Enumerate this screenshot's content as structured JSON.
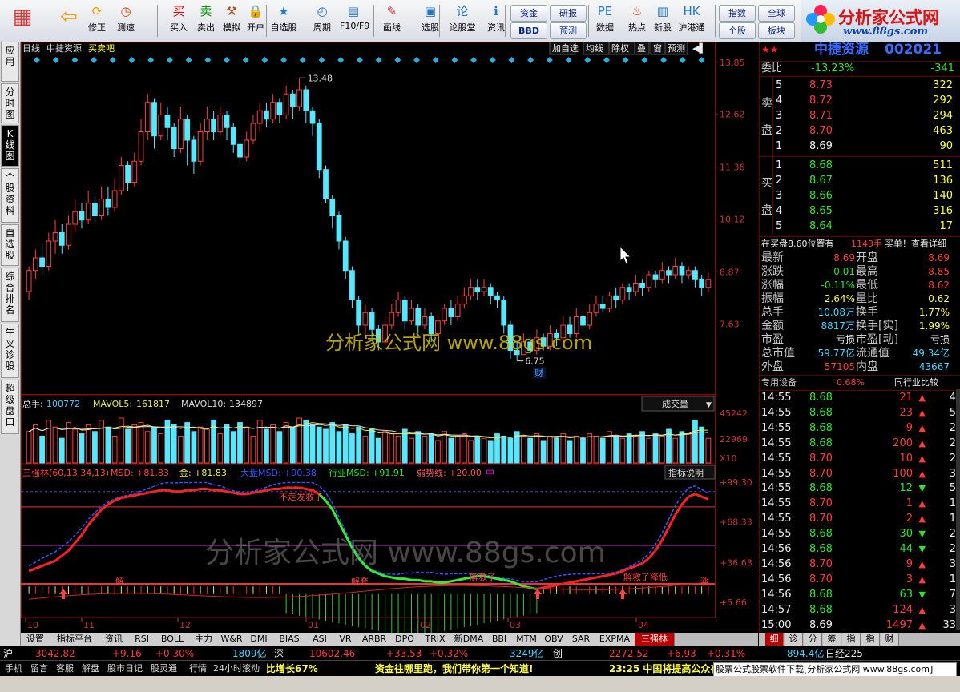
{
  "toolbar": {
    "buttons": [
      {
        "label": "",
        "icon": "windows-grid-icon"
      },
      {
        "label": "",
        "icon": "back-arrow-icon"
      },
      {
        "label": "修正",
        "icon": "refresh-icon"
      },
      {
        "label": "测速",
        "icon": "clock-icon"
      },
      {
        "label": "买入",
        "icon": "buy-icon"
      },
      {
        "label": "卖出",
        "icon": "sell-icon"
      },
      {
        "label": "模拟",
        "icon": "hammer-icon"
      },
      {
        "label": "开户",
        "icon": "lock-icon"
      },
      {
        "label": "自选股",
        "icon": "star-icon"
      },
      {
        "label": "周期",
        "icon": "period-icon"
      },
      {
        "label": "F10/F9",
        "icon": "f10-icon"
      },
      {
        "label": "画线",
        "icon": "pencil-icon"
      },
      {
        "label": "选股",
        "icon": "select-icon"
      },
      {
        "label": "论股堂",
        "icon": "forum-icon"
      },
      {
        "label": "资讯",
        "icon": "info-icon"
      },
      {
        "label": "数据",
        "icon": "pe-icon"
      },
      {
        "label": "热点",
        "icon": "fire-icon"
      },
      {
        "label": "新股",
        "icon": "newstock-icon"
      },
      {
        "label": "沪港通",
        "icon": "hk-icon"
      }
    ],
    "small_buttons": [
      "资金",
      "研报",
      "BBD",
      "预测",
      "指数",
      "全球",
      "个股",
      "板块"
    ],
    "logo_title": "分析家公式网",
    "logo_url": "www.88gs.com"
  },
  "left_tabs": [
    "应用",
    "分时图",
    "K线图",
    "个股资料",
    "自选股",
    "综合排名",
    "牛叉诊股",
    "超级盘口"
  ],
  "chart": {
    "period": "日线",
    "stock_name": "中捷资源",
    "tag": "买卖吧",
    "top_buttons": [
      "加自选",
      "均线",
      "除权",
      "叠",
      "窗",
      "预测"
    ],
    "watermark": "分析家公式网 www.88gs.com",
    "price_axis": [
      "13.85",
      "12.62",
      "11.36",
      "10.12",
      "8.87",
      "7.63"
    ],
    "high_label": "13.48",
    "low_label": "6.75",
    "fin_marker": "财",
    "vol_header": {
      "label": "总手:",
      "total": "100772",
      "mavol5_label": "MAVOL5:",
      "mavol5": "161817",
      "mavol10_label": "MAVOL10:",
      "mavol10": "134897"
    },
    "vol_dropdown": "成交量",
    "vol_axis": [
      "45242",
      "22969",
      "X10"
    ],
    "ind_header": {
      "name": "三强林(60,13,34,13)",
      "msd": "MSD: +81.83",
      "gold": "金: +81.83",
      "market": "大盘MSD: +90.38",
      "industry": "行业MSD: +91.91",
      "weak": "弱势线: +20.00",
      "mid": "中"
    },
    "ind_button": "指标说明",
    "ind_axis": [
      "+99.30",
      "+68.33",
      "+36.63",
      "+5.66"
    ],
    "ind_text": {
      "t1": "不走发救了",
      "t2": "解",
      "t3": "解套",
      "t4": "解套了",
      "t5": "解救",
      "t6": "解救了",
      "t7": "解救了降低",
      "t8": "解",
      "t9": "涨"
    },
    "month_labels": [
      "10",
      "11",
      "12",
      "01",
      "02",
      "03",
      "04"
    ]
  },
  "chart_data": {
    "type": "candlestick",
    "title": "",
    "ylim": [
      6.0,
      14.0
    ],
    "price_labels": {
      "high": 13.48,
      "low": 6.75
    },
    "candles": [
      [
        8.4,
        8.9,
        8.2,
        9.0
      ],
      [
        8.9,
        9.2,
        8.7,
        9.4
      ],
      [
        9.2,
        9.0,
        8.8,
        9.5
      ],
      [
        9.0,
        9.6,
        8.9,
        9.8
      ],
      [
        9.6,
        9.8,
        9.3,
        10.1
      ],
      [
        9.8,
        9.5,
        9.3,
        10.0
      ],
      [
        9.5,
        10.0,
        9.4,
        10.2
      ],
      [
        10.0,
        10.3,
        9.8,
        10.6
      ],
      [
        10.3,
        10.1,
        9.9,
        10.5
      ],
      [
        10.1,
        10.5,
        10.0,
        10.8
      ],
      [
        10.5,
        10.2,
        10.0,
        10.7
      ],
      [
        10.2,
        10.6,
        10.1,
        10.9
      ],
      [
        10.6,
        10.4,
        10.2,
        10.9
      ],
      [
        10.4,
        10.8,
        10.3,
        11.1
      ],
      [
        10.8,
        11.4,
        10.7,
        11.6
      ],
      [
        11.4,
        11.0,
        10.8,
        11.5
      ],
      [
        11.0,
        11.5,
        10.9,
        11.7
      ],
      [
        11.5,
        12.2,
        11.4,
        12.5
      ],
      [
        12.2,
        12.9,
        12.0,
        13.1
      ],
      [
        12.9,
        12.1,
        11.8,
        13.0
      ],
      [
        12.1,
        12.6,
        12.0,
        12.9
      ],
      [
        12.6,
        12.3,
        12.0,
        12.8
      ],
      [
        12.3,
        11.8,
        11.6,
        12.4
      ],
      [
        11.8,
        12.5,
        11.7,
        12.8
      ],
      [
        12.5,
        12.0,
        11.4,
        12.6
      ],
      [
        12.0,
        11.5,
        11.2,
        12.1
      ],
      [
        11.5,
        12.2,
        11.4,
        12.4
      ],
      [
        12.2,
        12.5,
        12.0,
        12.8
      ],
      [
        12.5,
        12.2,
        12.0,
        12.7
      ],
      [
        12.2,
        12.6,
        12.1,
        12.8
      ],
      [
        12.6,
        12.3,
        12.0,
        12.7
      ],
      [
        12.3,
        11.9,
        11.7,
        12.4
      ],
      [
        11.9,
        11.6,
        11.4,
        12.0
      ],
      [
        11.6,
        12.0,
        11.5,
        12.2
      ],
      [
        12.0,
        12.4,
        11.9,
        12.6
      ],
      [
        12.4,
        12.7,
        12.2,
        12.9
      ],
      [
        12.7,
        12.5,
        12.3,
        12.9
      ],
      [
        12.5,
        12.9,
        12.4,
        13.1
      ],
      [
        12.9,
        12.6,
        12.4,
        13.0
      ],
      [
        12.6,
        13.1,
        12.5,
        13.3
      ],
      [
        13.1,
        12.8,
        12.5,
        13.2
      ],
      [
        12.8,
        13.2,
        12.7,
        13.48
      ],
      [
        13.2,
        12.7,
        12.4,
        13.3
      ],
      [
        12.7,
        12.4,
        12.1,
        12.8
      ],
      [
        12.4,
        11.3,
        11.1,
        12.5
      ],
      [
        11.3,
        10.6,
        10.5,
        11.4
      ],
      [
        10.6,
        10.2,
        9.9,
        10.7
      ],
      [
        10.2,
        9.6,
        9.4,
        10.3
      ],
      [
        9.6,
        8.9,
        8.7,
        9.7
      ],
      [
        8.9,
        8.2,
        8.0,
        9.0
      ],
      [
        8.2,
        7.6,
        7.4,
        8.3
      ],
      [
        7.6,
        7.9,
        7.3,
        8.1
      ],
      [
        7.9,
        7.5,
        7.3,
        8.0
      ],
      [
        7.5,
        7.2,
        7.0,
        7.6
      ],
      [
        7.2,
        7.6,
        7.1,
        7.8
      ],
      [
        7.6,
        7.9,
        7.5,
        8.1
      ],
      [
        7.9,
        8.2,
        7.8,
        8.4
      ],
      [
        8.2,
        7.7,
        7.5,
        8.3
      ],
      [
        7.7,
        8.0,
        7.6,
        8.2
      ],
      [
        8.0,
        7.6,
        7.4,
        8.1
      ],
      [
        7.6,
        7.8,
        7.5,
        8.0
      ],
      [
        7.8,
        7.4,
        7.2,
        7.9
      ],
      [
        7.4,
        7.7,
        7.3,
        7.9
      ],
      [
        7.7,
        8.0,
        7.6,
        8.1
      ],
      [
        8.0,
        7.8,
        7.6,
        8.2
      ],
      [
        7.8,
        8.1,
        7.7,
        8.3
      ],
      [
        8.1,
        8.3,
        8.0,
        8.5
      ],
      [
        8.3,
        8.5,
        8.2,
        8.7
      ],
      [
        8.5,
        8.4,
        8.2,
        8.7
      ],
      [
        8.4,
        8.5,
        8.3,
        8.7
      ],
      [
        8.5,
        8.3,
        8.1,
        8.6
      ],
      [
        8.3,
        8.2,
        8.0,
        8.4
      ],
      [
        8.2,
        7.6,
        7.4,
        8.3
      ],
      [
        7.6,
        7.0,
        6.8,
        7.7
      ],
      [
        7.0,
        6.9,
        6.75,
        7.2
      ],
      [
        6.9,
        7.2,
        6.9,
        7.4
      ],
      [
        7.2,
        7.0,
        6.9,
        7.3
      ],
      [
        7.0,
        7.3,
        6.9,
        7.5
      ],
      [
        7.3,
        7.1,
        7.0,
        7.4
      ],
      [
        7.1,
        7.4,
        7.0,
        7.6
      ],
      [
        7.4,
        7.3,
        7.1,
        7.5
      ],
      [
        7.3,
        7.6,
        7.2,
        7.8
      ],
      [
        7.6,
        7.4,
        7.3,
        7.8
      ],
      [
        7.4,
        7.8,
        7.3,
        8.0
      ],
      [
        7.8,
        7.6,
        7.4,
        7.9
      ],
      [
        7.6,
        7.9,
        7.5,
        8.1
      ],
      [
        7.9,
        8.1,
        7.8,
        8.3
      ],
      [
        8.1,
        8.0,
        7.9,
        8.3
      ],
      [
        8.0,
        8.3,
        7.9,
        8.4
      ],
      [
        8.3,
        8.2,
        8.0,
        8.5
      ],
      [
        8.2,
        8.5,
        8.1,
        8.6
      ],
      [
        8.5,
        8.4,
        8.2,
        8.6
      ],
      [
        8.4,
        8.6,
        8.3,
        8.8
      ],
      [
        8.6,
        8.5,
        8.3,
        8.7
      ],
      [
        8.5,
        8.8,
        8.4,
        8.9
      ],
      [
        8.8,
        8.7,
        8.5,
        8.9
      ],
      [
        8.7,
        8.9,
        8.6,
        9.1
      ],
      [
        8.9,
        8.8,
        8.6,
        9.0
      ],
      [
        8.8,
        9.0,
        8.7,
        9.2
      ],
      [
        9.0,
        8.8,
        8.6,
        9.1
      ],
      [
        8.8,
        8.9,
        8.7,
        9.0
      ],
      [
        8.9,
        8.7,
        8.5,
        9.0
      ],
      [
        8.7,
        8.5,
        8.3,
        8.8
      ],
      [
        8.5,
        8.69,
        8.4,
        8.85
      ]
    ],
    "volume": [
      70,
      85,
      60,
      95,
      80,
      55,
      90,
      75,
      65,
      85,
      70,
      95,
      80,
      60,
      100,
      75,
      85,
      90,
      70,
      80,
      65,
      95,
      85,
      60,
      90,
      70,
      80,
      75,
      95,
      65,
      85,
      70,
      90,
      80,
      60,
      95,
      75,
      85,
      70,
      90,
      80,
      100,
      95,
      85,
      80,
      75,
      90,
      70,
      85,
      65,
      80,
      60,
      75,
      55,
      70,
      65,
      60,
      75,
      55,
      70,
      60,
      65,
      50,
      70,
      55,
      60,
      65,
      50,
      60,
      55,
      50,
      65,
      60,
      55,
      70,
      60,
      55,
      65,
      50,
      60,
      55,
      65,
      50,
      60,
      55,
      65,
      60,
      55,
      70,
      60,
      55,
      65,
      60,
      70,
      55,
      65,
      60,
      75,
      55,
      70,
      65,
      95,
      80,
      55
    ],
    "msd_line": [
      30,
      32,
      34,
      36,
      38,
      42,
      46,
      52,
      58,
      66,
      72,
      78,
      82,
      85,
      87,
      88,
      89,
      90,
      91,
      92,
      93,
      93,
      92,
      92,
      93,
      93,
      94,
      94,
      93,
      93,
      92,
      91,
      90,
      90,
      91,
      92,
      93,
      94,
      94,
      95,
      95,
      95,
      94,
      93,
      90,
      85,
      78,
      68,
      58,
      48,
      40,
      34,
      30,
      28,
      26,
      25,
      24,
      24,
      23,
      23,
      22,
      22,
      21,
      21,
      22,
      23,
      24,
      25,
      26,
      26,
      25,
      24,
      23,
      22,
      20,
      18,
      17,
      16,
      17,
      18,
      19,
      20,
      21,
      22,
      23,
      24,
      25,
      26,
      27,
      28,
      30,
      32,
      34,
      36,
      40,
      46,
      54,
      64,
      74,
      82,
      88,
      90,
      88,
      86
    ]
  },
  "panel": {
    "name": "中捷资源",
    "code": "002021",
    "weibi_label": "委比",
    "weibi_pct": "-13.23%",
    "weibi_val": "-341",
    "sell_label": [
      "卖",
      "盘"
    ],
    "buy_label": [
      "买",
      "盘"
    ],
    "sell": [
      {
        "n": "5",
        "price": "8.73",
        "vol": "322"
      },
      {
        "n": "4",
        "price": "8.72",
        "vol": "292"
      },
      {
        "n": "3",
        "price": "8.71",
        "vol": "294"
      },
      {
        "n": "2",
        "price": "8.70",
        "vol": "463"
      },
      {
        "n": "1",
        "price": "8.69",
        "vol": "90"
      }
    ],
    "buy": [
      {
        "n": "1",
        "price": "8.68",
        "vol": "511"
      },
      {
        "n": "2",
        "price": "8.67",
        "vol": "136"
      },
      {
        "n": "3",
        "price": "8.66",
        "vol": "140"
      },
      {
        "n": "4",
        "price": "8.65",
        "vol": "316"
      },
      {
        "n": "5",
        "price": "8.64",
        "vol": "17"
      }
    ],
    "notice": {
      "text": "在买盘8.60位置有",
      "vol": "1143手",
      "tail": "买单！查看详细"
    },
    "stats": [
      {
        "l1": "最新",
        "v1": "8.69",
        "l2": "开盘",
        "v2": "8.69"
      },
      {
        "l1": "涨跌",
        "v1": "-0.01",
        "l2": "最高",
        "v2": "8.85"
      },
      {
        "l1": "涨幅",
        "v1": "-0.11%",
        "l2": "最低",
        "v2": "8.62"
      },
      {
        "l1": "振幅",
        "v1": "2.64%",
        "l2": "量比",
        "v2": "0.62"
      },
      {
        "l1": "总手",
        "v1": "10.08万",
        "l2": "换手",
        "v2": "1.77%"
      },
      {
        "l1": "金额",
        "v1": "8817万",
        "l2": "换手[实]",
        "v2": "1.99%"
      },
      {
        "l1": "市盈",
        "v1": "亏损",
        "l2": "市盈[动]",
        "v2": "亏损"
      },
      {
        "l1": "总市值",
        "v1": "59.77亿",
        "l2": "流通值",
        "v2": "49.34亿"
      },
      {
        "l1": "外盘",
        "v1": "57105",
        "l2": "内盘",
        "v2": "43667"
      }
    ],
    "special": {
      "label": "专用设备",
      "pct": "0.68%",
      "link": "同行业比较"
    },
    "ticks": [
      {
        "t": "14:55",
        "p": "8.68",
        "v": "21",
        "d": "up",
        "n": "4"
      },
      {
        "t": "14:55",
        "p": "8.68",
        "v": "23",
        "d": "up",
        "n": "5"
      },
      {
        "t": "14:55",
        "p": "8.68",
        "v": "9",
        "d": "up",
        "n": "2"
      },
      {
        "t": "14:55",
        "p": "8.68",
        "v": "200",
        "d": "up",
        "n": "2"
      },
      {
        "t": "14:55",
        "p": "8.70",
        "v": "10",
        "d": "up",
        "n": "2"
      },
      {
        "t": "14:55",
        "p": "8.70",
        "v": "100",
        "d": "up",
        "n": "3"
      },
      {
        "t": "14:55",
        "p": "8.68",
        "v": "12",
        "d": "down",
        "n": "5"
      },
      {
        "t": "14:55",
        "p": "8.70",
        "v": "1",
        "d": "up",
        "n": "1"
      },
      {
        "t": "14:55",
        "p": "8.70",
        "v": "2",
        "d": "up",
        "n": "1"
      },
      {
        "t": "14:55",
        "p": "8.68",
        "v": "30",
        "d": "down",
        "n": "2"
      },
      {
        "t": "14:56",
        "p": "8.68",
        "v": "44",
        "d": "down",
        "n": "2"
      },
      {
        "t": "14:56",
        "p": "8.70",
        "v": "9",
        "d": "up",
        "n": "3"
      },
      {
        "t": "14:56",
        "p": "8.70",
        "v": "3",
        "d": "up",
        "n": "1"
      },
      {
        "t": "14:56",
        "p": "8.68",
        "v": "63",
        "d": "down",
        "n": "7"
      },
      {
        "t": "14:57",
        "p": "8.68",
        "v": "124",
        "d": "up",
        "n": "3"
      },
      {
        "t": "15:00",
        "p": "8.69",
        "v": "1497",
        "d": "up",
        "n": "33"
      }
    ]
  },
  "indicator_tabs": [
    "设置",
    "指标平台",
    "资讯",
    "RSI",
    "BOLL",
    "主力",
    "W&R",
    "DMI",
    "BIAS",
    "ASI",
    "VR",
    "ARBR",
    "DPO",
    "TRIX",
    "新DMA",
    "BBI",
    "MTM",
    "OBV",
    "SAR",
    "EXPMA",
    "三强林"
  ],
  "panel_tabs": [
    "细",
    "诊",
    "分",
    "筹",
    "指",
    "指",
    "财"
  ],
  "status1": {
    "sh": "沪",
    "sh_val": "3042.82",
    "sh_chg": "+9.16",
    "sh_pct": "+0.30%",
    "sh_amt": "1809亿",
    "sz": "深",
    "sz_val": "10602.46",
    "sz_chg": "+33.53",
    "sz_pct": "+0.32%",
    "sz_amt": "3249亿",
    "cy": "创",
    "cy_val": "2272.52",
    "cy_chg": "+6.93",
    "cy_pct": "+0.31%",
    "zx_amt": "894.4亿",
    "rj": "日经225"
  },
  "status2": {
    "items": [
      "手机",
      "留言",
      "客服",
      "解盘",
      "股市日记",
      "股灵通",
      "行情",
      "24小时滚动"
    ],
    "ticker1": "比增长67%",
    "ticker2": "资金往哪里跑，我们带你第一个知道!",
    "ticker3": "23:25 中国将提高公众在",
    "right": "股票公式股票软件下载[分析家公式网 www.88gs.com]"
  }
}
